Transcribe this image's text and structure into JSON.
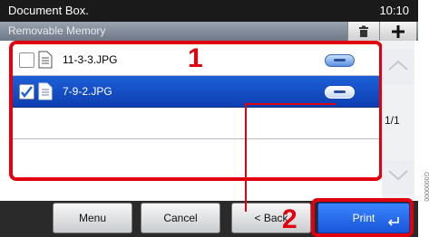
{
  "header": {
    "title": "Document Box.",
    "time": "10:10"
  },
  "subheader": {
    "title": "Removable Memory",
    "trash_icon": "trash-icon",
    "plus_icon": "plus-icon"
  },
  "files": [
    {
      "name": "11-3-3.JPG",
      "checked": false,
      "selected": false
    },
    {
      "name": "7-9-2.JPG",
      "checked": true,
      "selected": true
    }
  ],
  "page_indicator": "1/1",
  "buttons": {
    "menu": "Menu",
    "cancel": "Cancel",
    "back": "< Back",
    "print": "Print"
  },
  "callouts": {
    "one": "1",
    "two": "2"
  },
  "side_ref": "G0000000"
}
